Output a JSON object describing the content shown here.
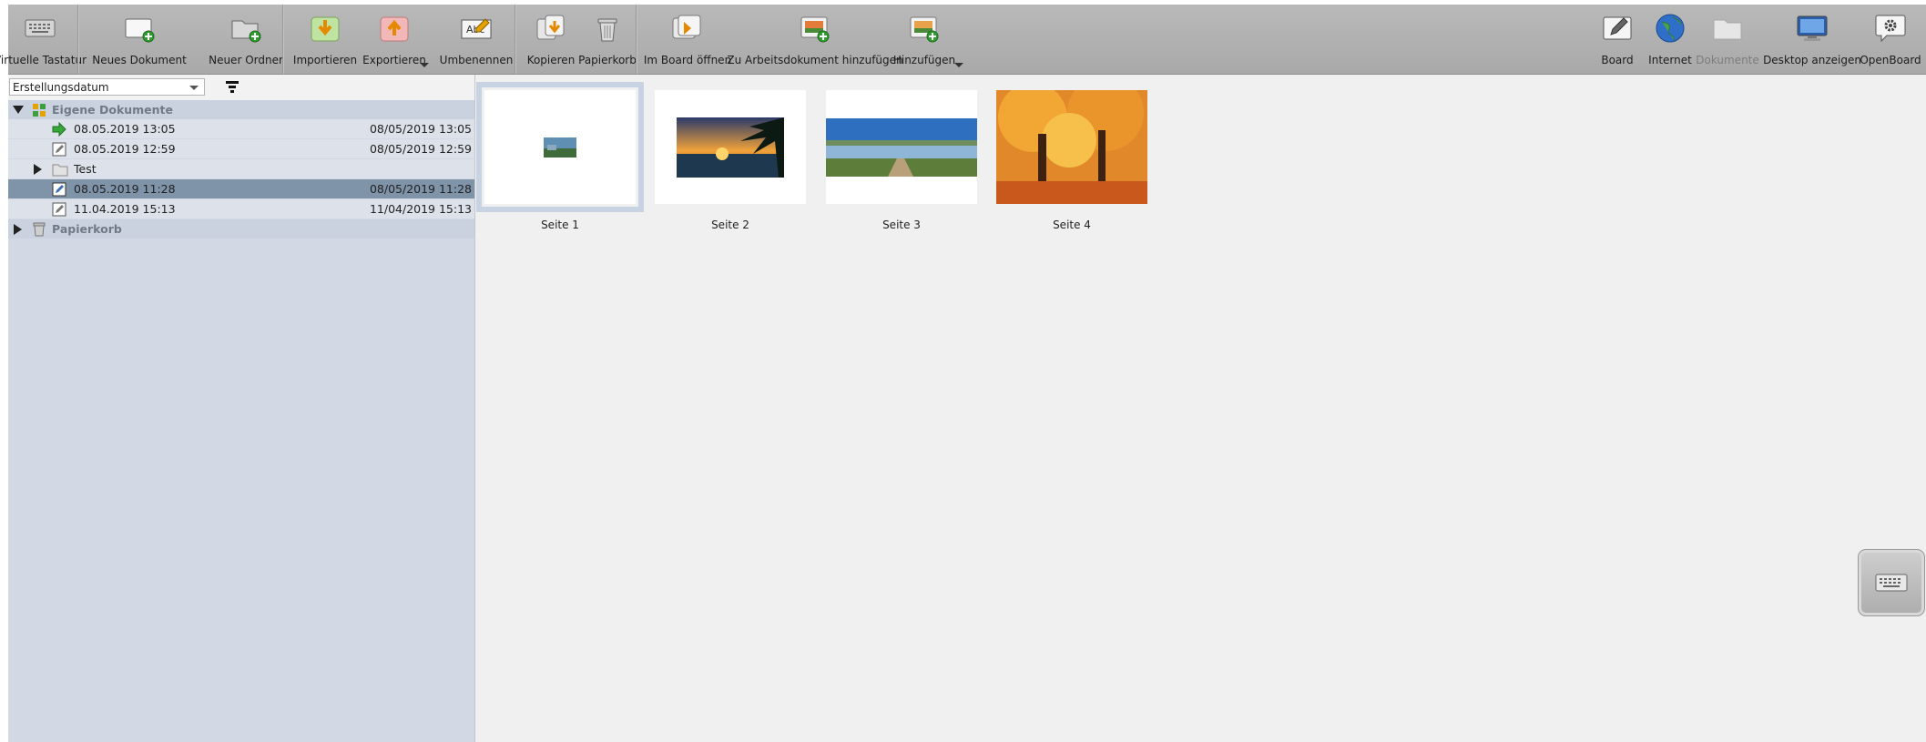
{
  "toolbar": {
    "virtual_keyboard": "Virtuelle Tastatur",
    "new_document": "Neues Dokument",
    "new_folder": "Neuer Ordner",
    "import": "Importieren",
    "export": "Exportieren",
    "rename": "Umbenennen",
    "copy": "Kopieren",
    "trash": "Papierkorb",
    "open_in_board": "Im Board öffnen",
    "add_to_working_document": "Zu Arbeitsdokument hinzufügen",
    "add": "Hinzufügen",
    "board": "Board",
    "internet": "Internet",
    "documents": "Dokumente",
    "show_desktop": "Desktop anzeigen",
    "openboard": "OpenBoard"
  },
  "sidebar": {
    "sort_by": "Erstellungsdatum",
    "tree": {
      "my_documents": "Eigene Dokumente",
      "items": [
        {
          "name": "08.05.2019 13:05",
          "date": "08/05/2019 13:05",
          "icon": "current-document-arrow-icon"
        },
        {
          "name": "08.05.2019 12:59",
          "date": "08/05/2019 12:59",
          "icon": "document-icon"
        },
        {
          "name": "Test",
          "date": "",
          "icon": "folder-icon"
        },
        {
          "name": "08.05.2019 11:28",
          "date": "08/05/2019 11:28",
          "icon": "document-icon",
          "selected": true
        },
        {
          "name": "11.04.2019 15:13",
          "date": "11/04/2019 15:13",
          "icon": "document-icon"
        }
      ],
      "trash": "Papierkorb"
    }
  },
  "pages": [
    {
      "label": "Seite 1",
      "selected": true
    },
    {
      "label": "Seite 2"
    },
    {
      "label": "Seite 3"
    },
    {
      "label": "Seite 4"
    }
  ],
  "colors": {
    "toolbar_bg": "#b0b0b0",
    "sidebar_bg": "#d3d9e4",
    "selected_row": "#7f93a9",
    "main_bg": "#f0f0f0"
  }
}
